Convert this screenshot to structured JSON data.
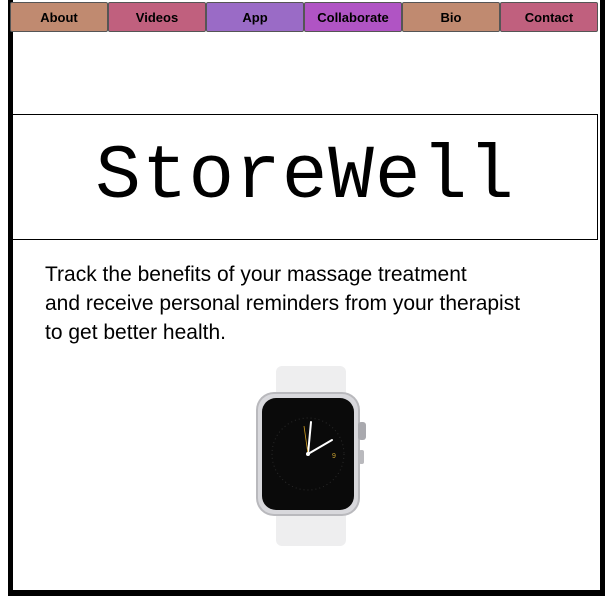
{
  "nav": {
    "items": [
      {
        "label": "About",
        "color": "#c08a70"
      },
      {
        "label": "Videos",
        "color": "#c0607e"
      },
      {
        "label": "App",
        "color": "#9a6bc6"
      },
      {
        "label": "Collaborate",
        "color": "#b054c4"
      },
      {
        "label": "Bio",
        "color": "#c08a70"
      },
      {
        "label": "Contact",
        "color": "#c0607e"
      }
    ]
  },
  "hero": {
    "brand": "StoreWell"
  },
  "tagline": {
    "line1": "Track the benefits of your massage treatment",
    "line2": "and receive personal reminders from your therapist",
    "line3": "to get better health."
  },
  "product": {
    "icon": "smartwatch-icon"
  }
}
